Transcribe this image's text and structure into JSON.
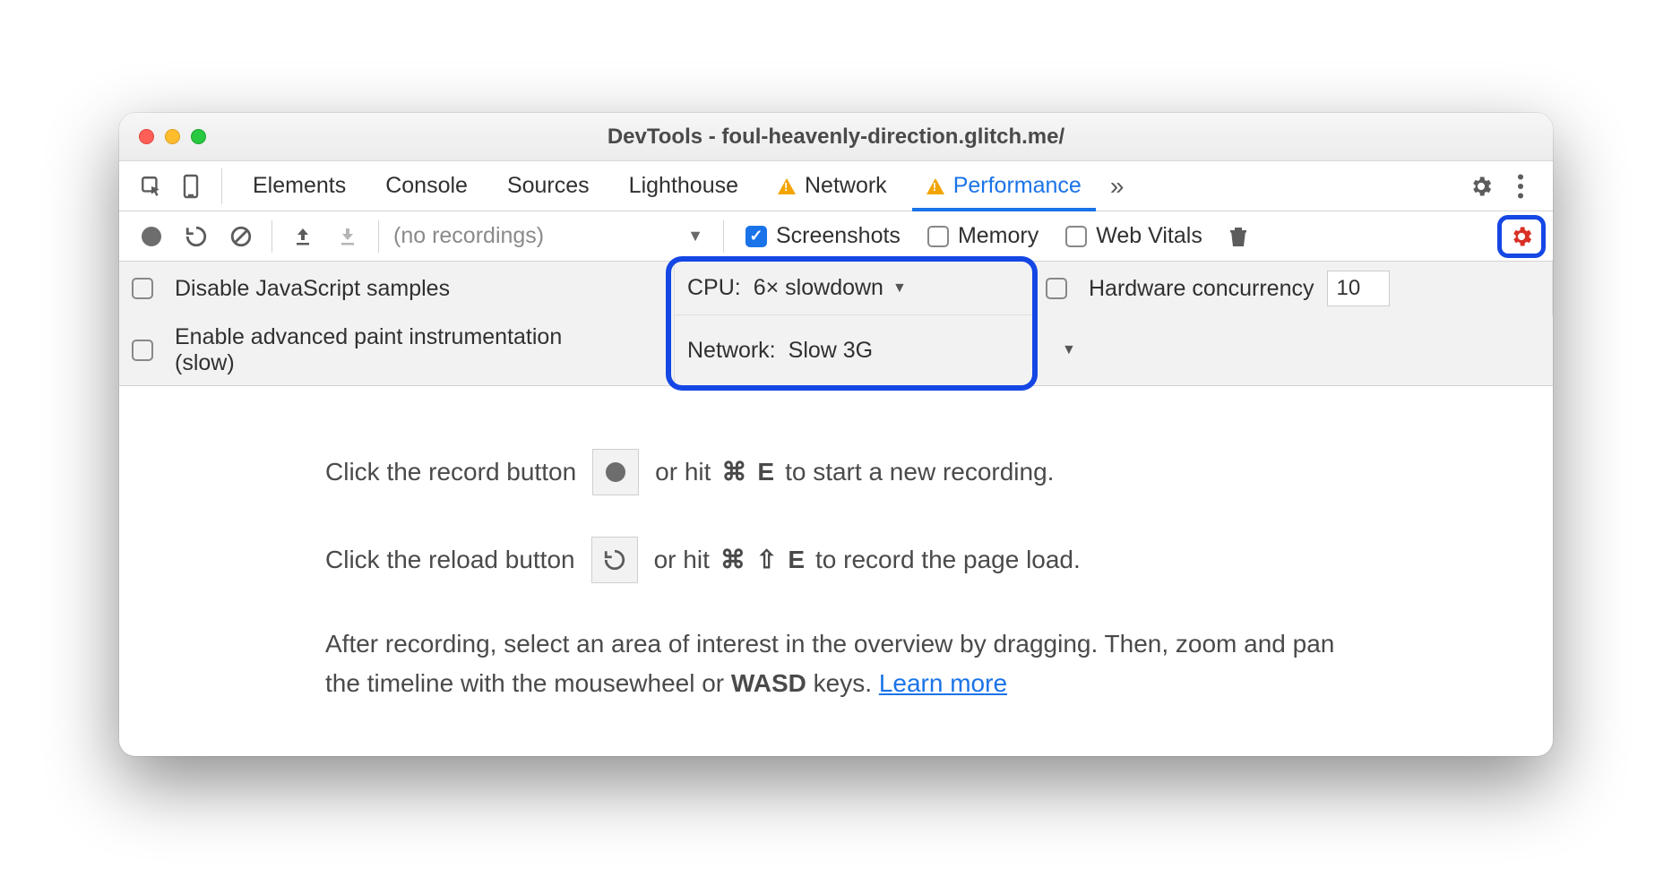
{
  "window": {
    "title": "DevTools - foul-heavenly-direction.glitch.me/"
  },
  "tabs": {
    "items": [
      "Elements",
      "Console",
      "Sources",
      "Lighthouse",
      "Network",
      "Performance"
    ],
    "active": "Performance"
  },
  "toolbar": {
    "recordings_label": "(no recordings)",
    "screenshots_label": "Screenshots",
    "memory_label": "Memory",
    "webvitals_label": "Web Vitals"
  },
  "settings": {
    "disable_js_label": "Disable JavaScript samples",
    "paint_label_1": "Enable advanced paint instrumentation",
    "paint_label_2": "(slow)",
    "cpu_label": "CPU:",
    "cpu_value": "6× slowdown",
    "network_label": "Network:",
    "network_value": "Slow 3G",
    "hc_label": "Hardware concurrency",
    "hc_value": "10"
  },
  "hints": {
    "l1a": "Click the record button",
    "l1b": "or hit",
    "l1_key1": "⌘",
    "l1_key2": "E",
    "l1c": "to start a new recording.",
    "l2a": "Click the reload button",
    "l2b": "or hit",
    "l2_key1": "⌘",
    "l2_key2": "⇧",
    "l2_key3": "E",
    "l2c": "to record the page load.",
    "l3a": "After recording, select an area of interest in the overview by dragging. Then, zoom and pan the timeline with the mousewheel or ",
    "l3_wasd": "WASD",
    "l3b": " keys. ",
    "learn_more": "Learn more"
  }
}
